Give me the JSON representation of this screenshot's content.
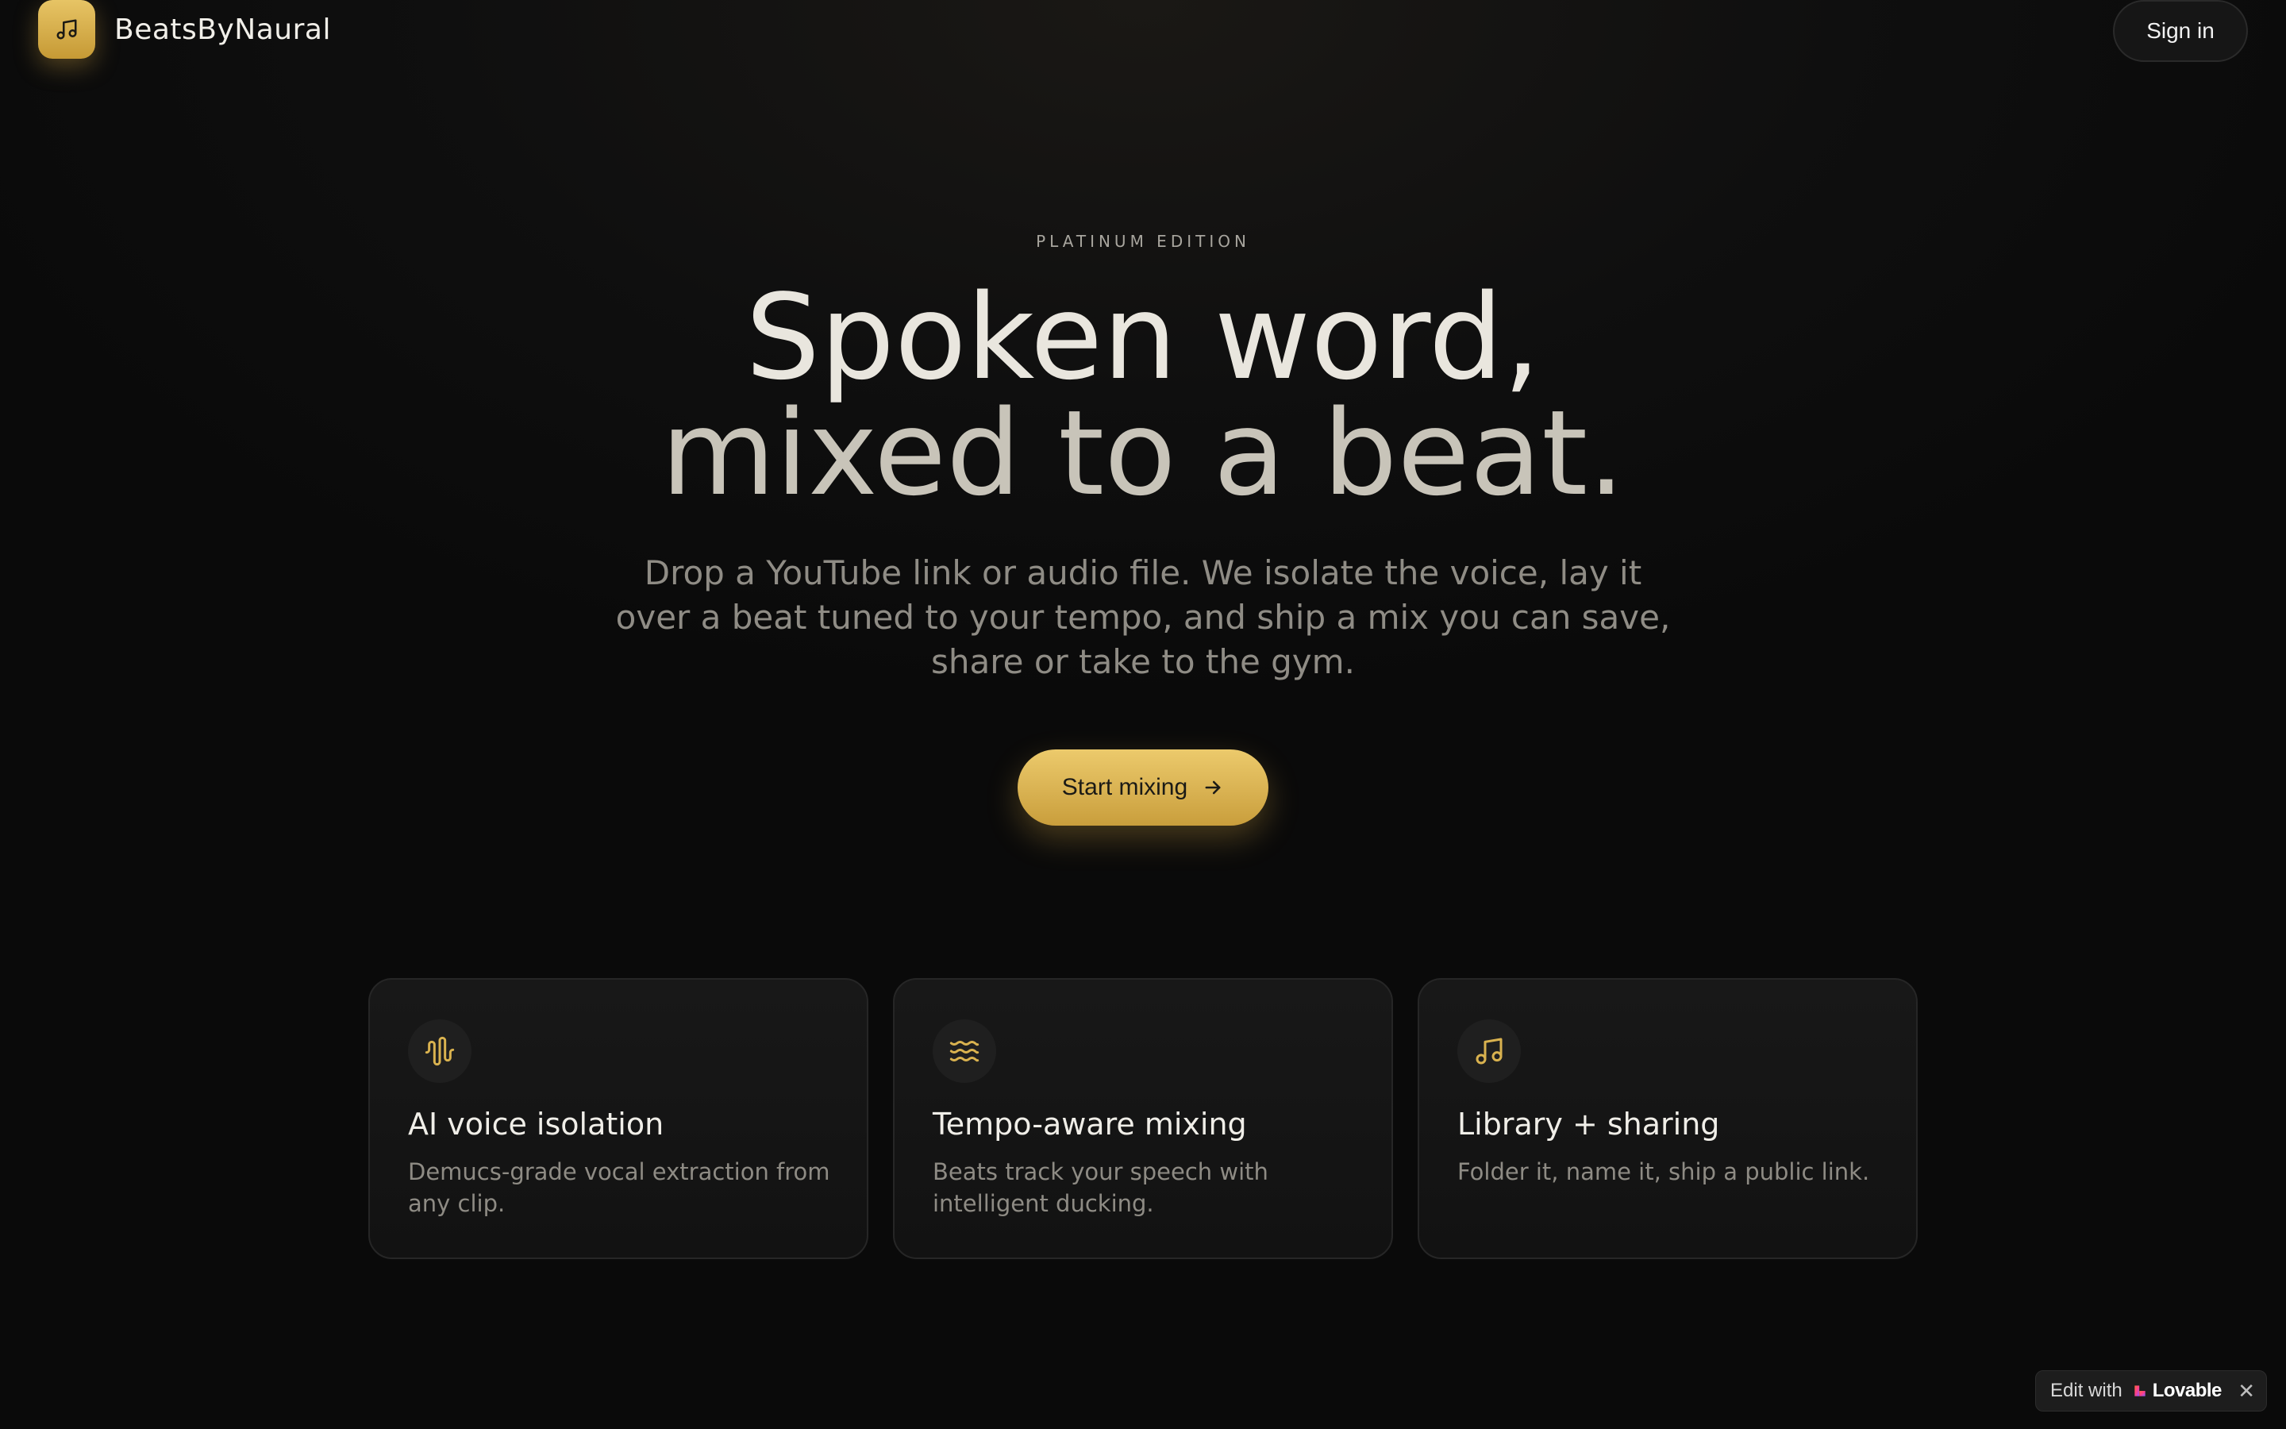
{
  "header": {
    "brand": "BeatsByNaural",
    "sign_in_label": "Sign in",
    "logo_icon": "music-note-icon"
  },
  "hero": {
    "eyebrow": "PLATINUM EDITION",
    "headline_line1": "Spoken word,",
    "headline_line2": "mixed to a beat.",
    "subtitle": "Drop a YouTube link or audio file. We isolate the voice, lay it over a beat tuned to your tempo, and ship a mix you can save, share or take to the gym.",
    "cta_label": "Start mixing",
    "cta_icon": "arrow-right-icon"
  },
  "features": [
    {
      "icon": "audio-waveform-icon",
      "title": "AI voice isolation",
      "description": "Demucs-grade vocal extraction from any clip."
    },
    {
      "icon": "waves-icon",
      "title": "Tempo-aware mixing",
      "description": "Beats track your speech with intelligent ducking."
    },
    {
      "icon": "music-note-icon",
      "title": "Library + sharing",
      "description": "Folder it, name it, ship a public link."
    }
  ],
  "badge": {
    "prefix": "Edit with",
    "brand": "Lovable",
    "close": "✕"
  },
  "colors": {
    "accent_gold": "#d9b24f",
    "background": "#0b0b0b",
    "card_background": "#151515"
  }
}
